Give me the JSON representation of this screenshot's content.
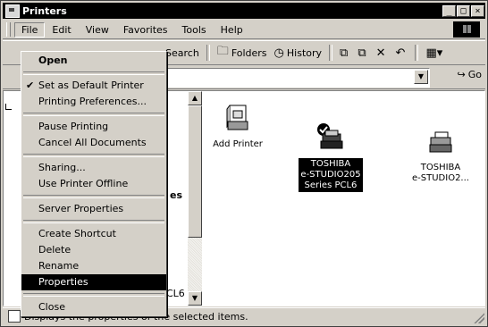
{
  "window": {
    "title": "Printers"
  },
  "menubar": {
    "items": [
      {
        "id": "file",
        "label": "File"
      },
      {
        "id": "edit",
        "label": "Edit"
      },
      {
        "id": "view",
        "label": "View"
      },
      {
        "id": "favorites",
        "label": "Favorites"
      },
      {
        "id": "tools",
        "label": "Tools"
      },
      {
        "id": "help",
        "label": "Help"
      }
    ]
  },
  "toolbar": {
    "search_label": "Search",
    "folders_label": "Folders",
    "history_label": "History"
  },
  "addressbar": {
    "go_label": "Go"
  },
  "file_menu": {
    "open": "Open",
    "set_default": "Set as Default Printer",
    "printing_preferences": "Printing Preferences...",
    "pause_printing": "Pause Printing",
    "cancel_all": "Cancel All Documents",
    "sharing": "Sharing...",
    "use_offline": "Use Printer Offline",
    "server_properties": "Server Properties",
    "create_shortcut": "Create Shortcut",
    "delete": "Delete",
    "rename": "Rename",
    "properties": "Properties",
    "close": "Close"
  },
  "left_pane": {
    "fragment_heading": "es",
    "fragment_name": "CL6"
  },
  "printers": [
    {
      "label": "Add Printer"
    },
    {
      "label": "TOSHIBA\ne-STUDIO205\nSeries PCL6"
    },
    {
      "label": "TOSHIBA\ne-STUDIO2..."
    }
  ],
  "status": {
    "text": "Displays the properties of the selected items."
  }
}
